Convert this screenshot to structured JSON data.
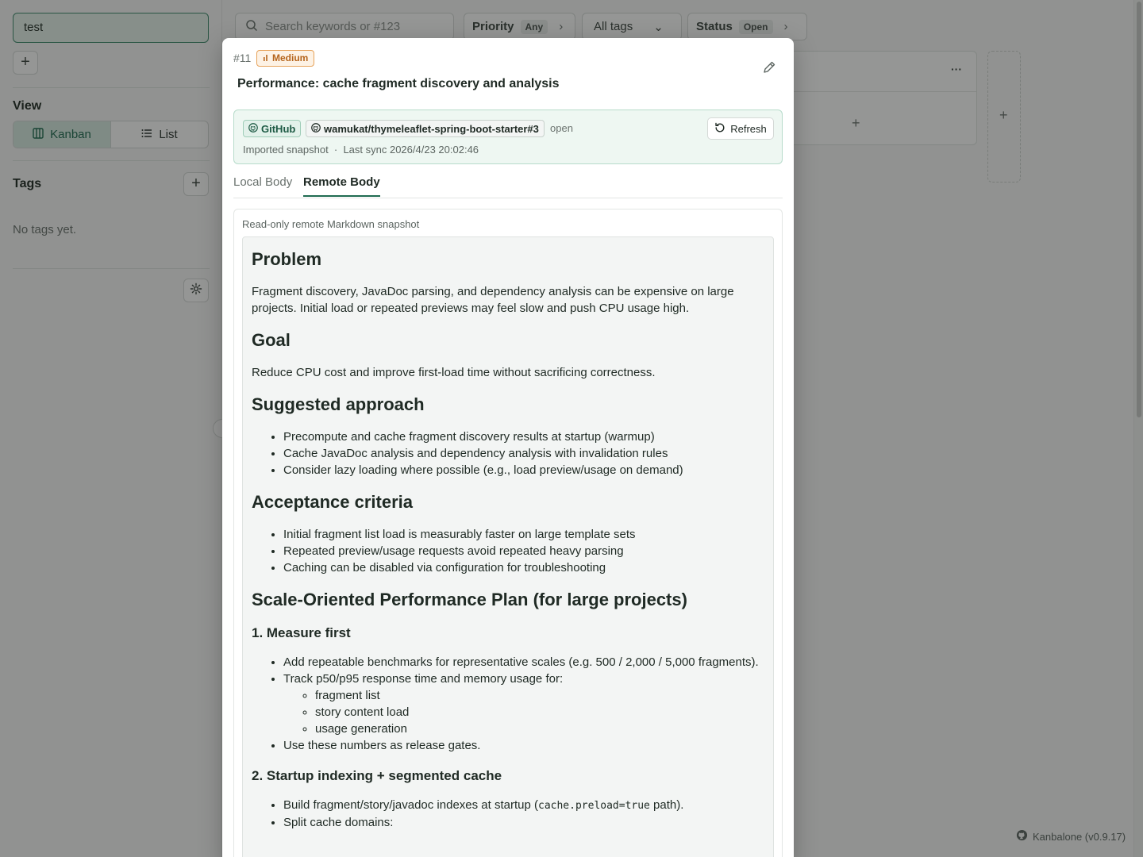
{
  "sidebar": {
    "board_name": "test",
    "add_label": "+",
    "view_title": "View",
    "view_kanban": "Kanban",
    "view_list": "List",
    "tags_title": "Tags",
    "tags_add": "+",
    "no_tags": "No tags yet."
  },
  "topbar": {
    "search_placeholder": "Search keywords or #123",
    "priority_label": "Priority",
    "priority_value": "Any",
    "tags_select": "All tags",
    "status_label": "Status",
    "status_value": "Open"
  },
  "board": {
    "column_more": "···",
    "column_add": "+",
    "add_column": "+"
  },
  "footer": {
    "brand": "Kanbalone (v0.9.17)"
  },
  "modal": {
    "issue_number": "#11",
    "priority_badge": "Medium",
    "title": "Performance: cache fragment discovery and analysis",
    "source_chip": "GitHub",
    "repo_chip": "wamukat/thymeleaflet-spring-boot-starter#3",
    "remote_state": "open",
    "sync_meta": "Imported snapshot  ·  Last sync 2026/4/23 20:02:46",
    "refresh_label": "Refresh",
    "tabs": [
      "Local Body",
      "Remote Body"
    ],
    "remote_label": "Read-only remote Markdown snapshot"
  },
  "markdown": {
    "h_problem": "Problem",
    "p_problem": "Fragment discovery, JavaDoc parsing, and dependency analysis can be expensive on large projects. Initial load or repeated previews may feel slow and push CPU usage high.",
    "h_goal": "Goal",
    "p_goal": "Reduce CPU cost and improve first-load time without sacrificing correctness.",
    "h_approach": "Suggested approach",
    "approach": [
      "Precompute and cache fragment discovery results at startup (warmup)",
      "Cache JavaDoc analysis and dependency analysis with invalidation rules",
      "Consider lazy loading where possible (e.g., load preview/usage on demand)"
    ],
    "h_acceptance": "Acceptance criteria",
    "acceptance": [
      "Initial fragment list load is measurably faster on large template sets",
      "Repeated preview/usage requests avoid repeated heavy parsing",
      "Caching can be disabled via configuration for troubleshooting"
    ],
    "h_plan": "Scale-Oriented Performance Plan (for large projects)",
    "h_measure": "1. Measure first",
    "measure_1": "Add repeatable benchmarks for representative scales (e.g. 500 / 2,000 / 5,000 fragments).",
    "measure_2": "Track p50/p95 response time and memory usage for:",
    "measure_sub": [
      "fragment list",
      "story content load",
      "usage generation"
    ],
    "measure_3": "Use these numbers as release gates.",
    "h_startup": "2. Startup indexing + segmented cache",
    "startup_1_pre": "Build fragment/story/javadoc indexes at startup (",
    "startup_1_code": "cache.preload=true",
    "startup_1_post": " path).",
    "startup_2": "Split cache domains:"
  }
}
